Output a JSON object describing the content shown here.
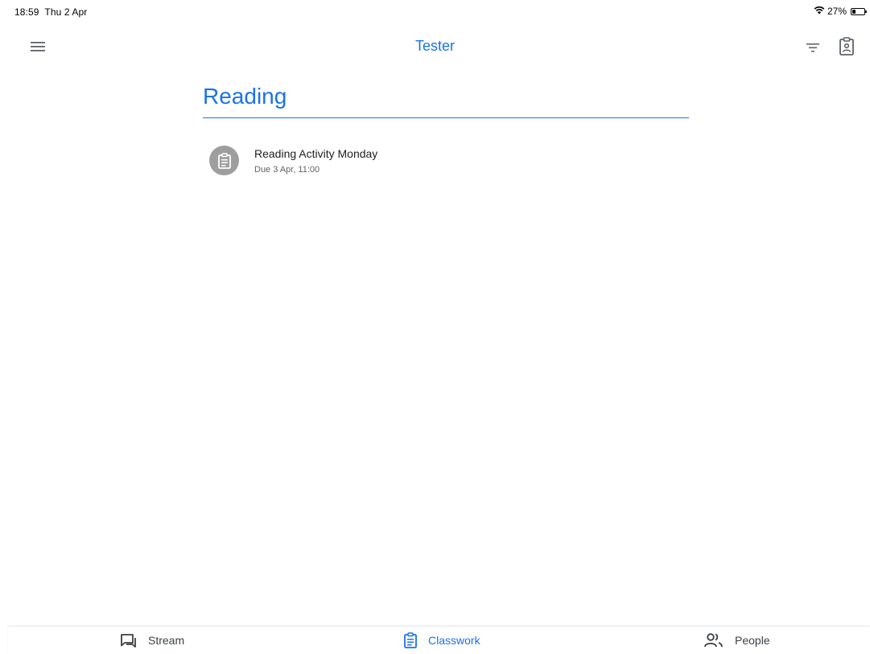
{
  "status_bar": {
    "time": "18:59",
    "date": "Thu 2 Apr",
    "battery_text": "27%",
    "battery_level": 0.27,
    "icons": [
      "wifi-icon",
      "battery-icon"
    ]
  },
  "app_bar": {
    "class_name": "Tester",
    "icons": [
      "menu-icon",
      "filter-icon",
      "class-folder-icon"
    ],
    "accent_color": "#1a73e8"
  },
  "topic": {
    "title": "Reading"
  },
  "assignments": [
    {
      "title": "Reading Activity Monday",
      "due": "Due 3 Apr, 11:00",
      "icon": "assignment-icon"
    }
  ],
  "bottom_nav": {
    "selected": "Classwork",
    "tabs": [
      {
        "label": "Stream",
        "icon": "stream-icon"
      },
      {
        "label": "Classwork",
        "icon": "classwork-icon"
      },
      {
        "label": "People",
        "icon": "people-icon"
      }
    ]
  }
}
